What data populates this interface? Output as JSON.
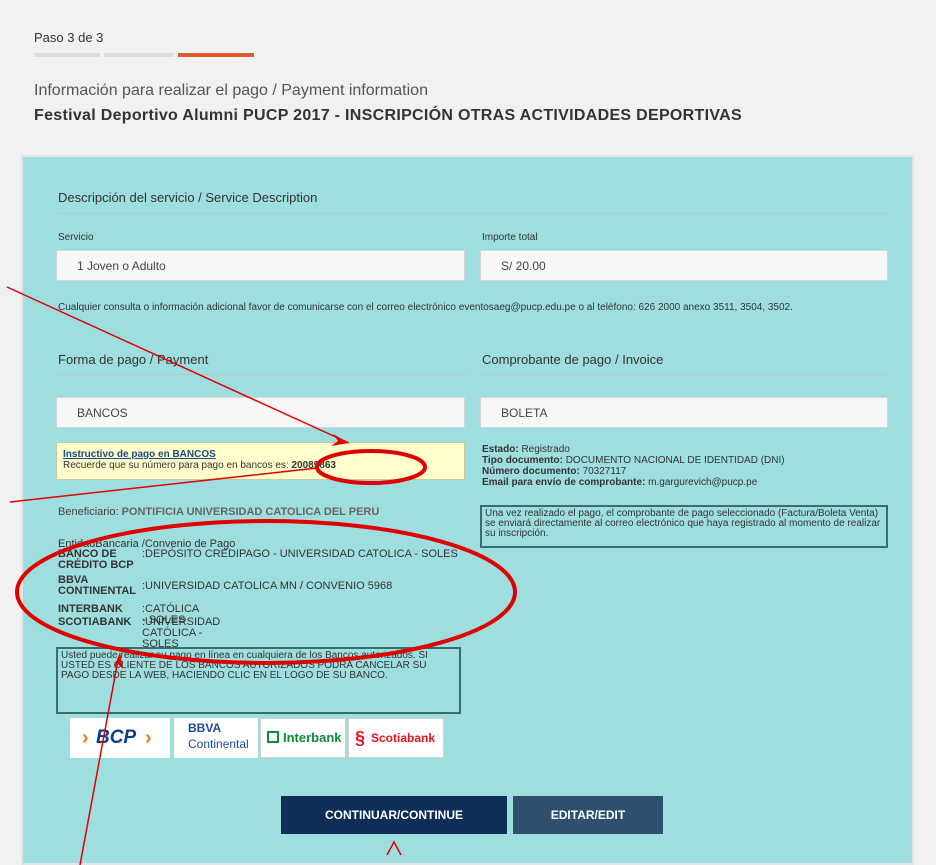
{
  "header": {
    "step": "Paso 3 de 3",
    "subtitle": "Información para realizar el pago / Payment information",
    "title": "Festival Deportivo Alumni PUCP 2017 - INSCRIPCIÓN OTRAS ACTIVIDADES DEPORTIVAS"
  },
  "service": {
    "heading": "Descripción del servicio / Service Description",
    "servicio_label": "Servicio",
    "servicio_value": "1 Joven o Adulto",
    "importe_label": "Importe total",
    "importe_value": "S/ 20.00",
    "contact_text": "Cualquier consulta o información adicional favor de comunicarse con el correo electrónico eventosaeg@pucp.edu.pe o al teléfono: 626 2000 anexo 3511, 3504, 3502."
  },
  "payment": {
    "heading": "Forma de pago / Payment",
    "method_value": "BANCOS",
    "instructivo_link": "Instructivo de pago en BANCOS",
    "recuerde_text": "Recuerde que su número para pago en bancos es: ",
    "payment_code": "20089863",
    "beneficiario_label": "Beneficiario: ",
    "beneficiario_value": "PONTIFICIA UNIVERSIDAD CATOLICA DEL PERU",
    "entidad_header": "EntidadBancaria /Convenio de Pago",
    "banks": [
      {
        "name": "BANCO DE CRÉDITO BCP",
        "value": ":DEPÓSITO CREDIPAGO - UNIVERSIDAD CATOLICA - SOLES"
      },
      {
        "name": "BBVA CONTINENTAL",
        "value": ":UNIVERSIDAD CATOLICA MN / CONVENIO 5968"
      },
      {
        "name": "INTERBANK",
        "value": ":CATÓLICA - SOLES"
      },
      {
        "name": "SCOTIABANK",
        "value": ":UNIVERSIDAD CATÓLICA - SOLES"
      }
    ],
    "online_notice": "Usted puede realizar su pago en línea en cualquiera de los Bancos autorizados. SI USTED ES CLIENTE DE LOS BANCOS AUTORIZADOS PODRA CANCELAR SU PAGO DESDE LA WEB, HACIENDO CLIC EN EL LOGO DE SU BANCO.",
    "logos": {
      "bcp": "BCP",
      "bbva_top": "BBVA",
      "bbva_bottom": "Continental",
      "interbank": "Interbank",
      "scotiabank": "Scotiabank"
    }
  },
  "invoice": {
    "heading": "Comprobante de pago / Invoice",
    "type_value": "BOLETA",
    "estado_label": "Estado: ",
    "estado_value": "Registrado",
    "tipo_doc_label": "Tipo documento: ",
    "tipo_doc_value": "DOCUMENTO NACIONAL DE IDENTIDAD (DNI)",
    "num_doc_label": "Número documento: ",
    "num_doc_value": "70327117",
    "email_label": "Email para envío de comprobante: ",
    "email_value": "m.gargurevich@pucp.pe",
    "notice": "Una vez realizado el pago, el comprobante de pago seleccionado (Factura/Boleta Venta) se enviará directamente al correo electrónico que haya registrado al momento de realizar su inscripción."
  },
  "buttons": {
    "continue": "CONTINUAR/CONTINUE",
    "edit": "EDITAR/EDIT"
  },
  "colors": {
    "panel": "#9fdede",
    "accent": "#e4582b",
    "annotation": "#e00000",
    "continue_button": "#0c2e57",
    "edit_button": "#2e4f6e"
  }
}
